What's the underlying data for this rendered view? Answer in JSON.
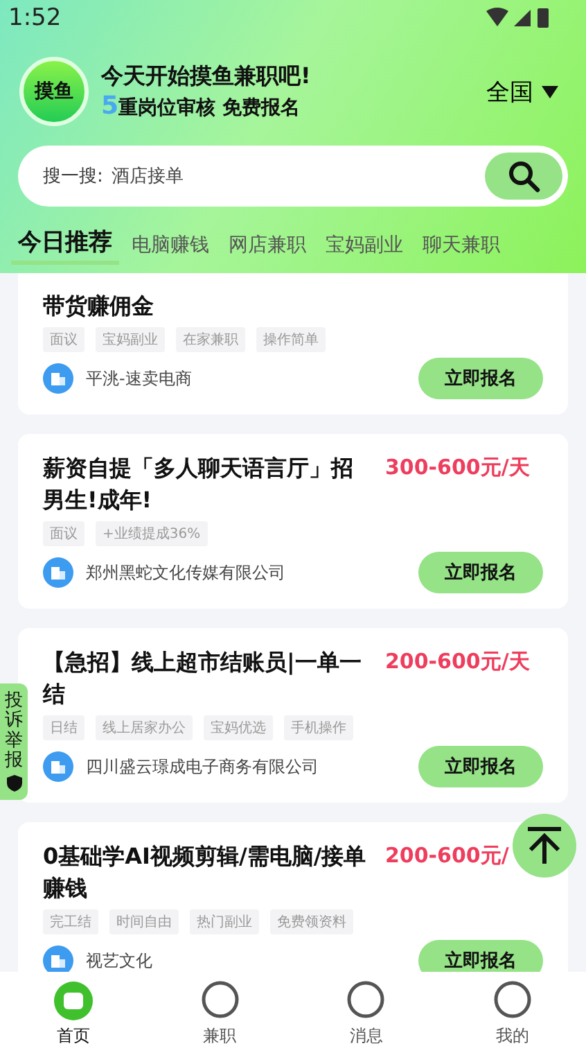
{
  "status_bar": {
    "time": "1:52"
  },
  "header": {
    "logo": "摸鱼",
    "title": "今天开始摸鱼兼职吧!",
    "subtitle_number": "5",
    "subtitle": "重岗位审核 免费报名",
    "region": "全国"
  },
  "search": {
    "label": "搜一搜:",
    "placeholder": "酒店接单"
  },
  "tabs": [
    {
      "label": "今日推荐",
      "selected": true
    },
    {
      "label": "电脑赚钱",
      "selected": false
    },
    {
      "label": "网店兼职",
      "selected": false
    },
    {
      "label": "宝妈副业",
      "selected": false
    },
    {
      "label": "聊天兼职",
      "selected": false
    }
  ],
  "jobs": [
    {
      "title": "带货赚佣金",
      "tags": [
        "面议",
        "宝妈副业",
        "在家兼职",
        "操作简单"
      ],
      "company": "平洮-速卖电商",
      "button": "立即报名"
    },
    {
      "title": "薪资自提「多人聊天语言厅」招男生!成年!",
      "price": "300-600元/天",
      "tags": [
        "面议",
        "+业绩提成36%"
      ],
      "company": "郑州黑蛇文化传媒有限公司",
      "button": "立即报名"
    },
    {
      "title": "【急招】线上超市结账员|一单一结",
      "price": "200-600元/天",
      "tags": [
        "日结",
        "线上居家办公",
        "宝妈优选",
        "手机操作"
      ],
      "company": "四川盛云璟成电子商务有限公司",
      "button": "立即报名"
    },
    {
      "title": "0基础学AI视频剪辑/需电脑/接单赚钱",
      "price": "200-600元/",
      "tags": [
        "完工结",
        "时间自由",
        "热门副业",
        "免费领资料"
      ],
      "company": "视艺文化",
      "button": "立即报名"
    }
  ],
  "report_tab": "投诉举报",
  "bottom_nav": [
    {
      "label": "首页",
      "selected": true
    },
    {
      "label": "兼职",
      "selected": false
    },
    {
      "label": "消息",
      "selected": false
    },
    {
      "label": "我的",
      "selected": false
    }
  ]
}
